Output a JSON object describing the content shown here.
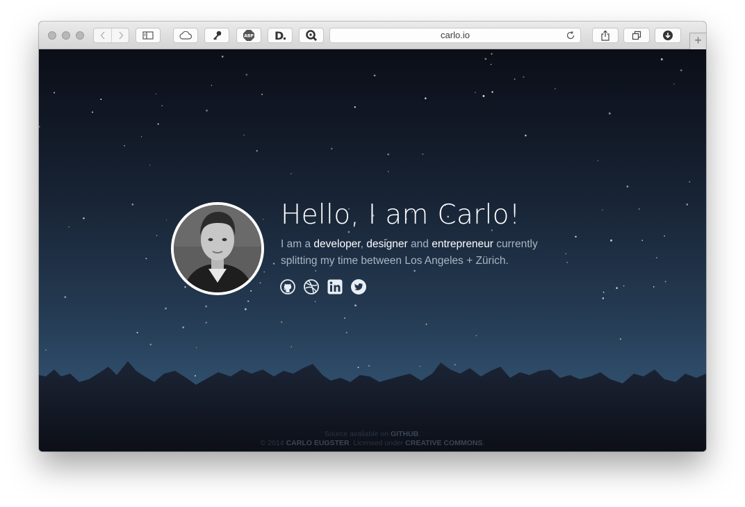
{
  "browser": {
    "url": "carlo.io",
    "new_tab_symbol": "+",
    "extension_icons": [
      "cloud-icon",
      "key-icon",
      "abp-icon",
      "d-icon",
      "search-extension-icon"
    ],
    "toolbar_icons": [
      "back-icon",
      "forward-icon",
      "sidebar-icon",
      "share-icon",
      "tabs-icon",
      "download-icon"
    ]
  },
  "hero": {
    "heading": "Hello, I am Carlo!",
    "intro": {
      "prefix": "I am a ",
      "role1": "developer",
      "sep1": ", ",
      "role2": "designer",
      "sep2": " and ",
      "role3": "entrepreneur",
      "rest": " currently splitting my time between Los Angeles + Zürich."
    },
    "social": [
      "github-icon",
      "dribbble-icon",
      "linkedin-icon",
      "twitter-icon"
    ]
  },
  "footer": {
    "line1_prefix": "Source avaliable on ",
    "line1_link": "GITHUB",
    "line1_suffix": ".",
    "line2_prefix": "© 2014 ",
    "line2_name": "CARLO EUGSTER",
    "line2_mid": ". Licensed under ",
    "line2_link": "CREATIVE COMMONS",
    "line2_suffix": "."
  },
  "colors": {
    "sky_top": "#0b0e17",
    "sky_bottom": "#34587a",
    "mountains": "#1a2132",
    "text_muted": "#a9b5c3",
    "text_highlight": "#ffffff"
  }
}
